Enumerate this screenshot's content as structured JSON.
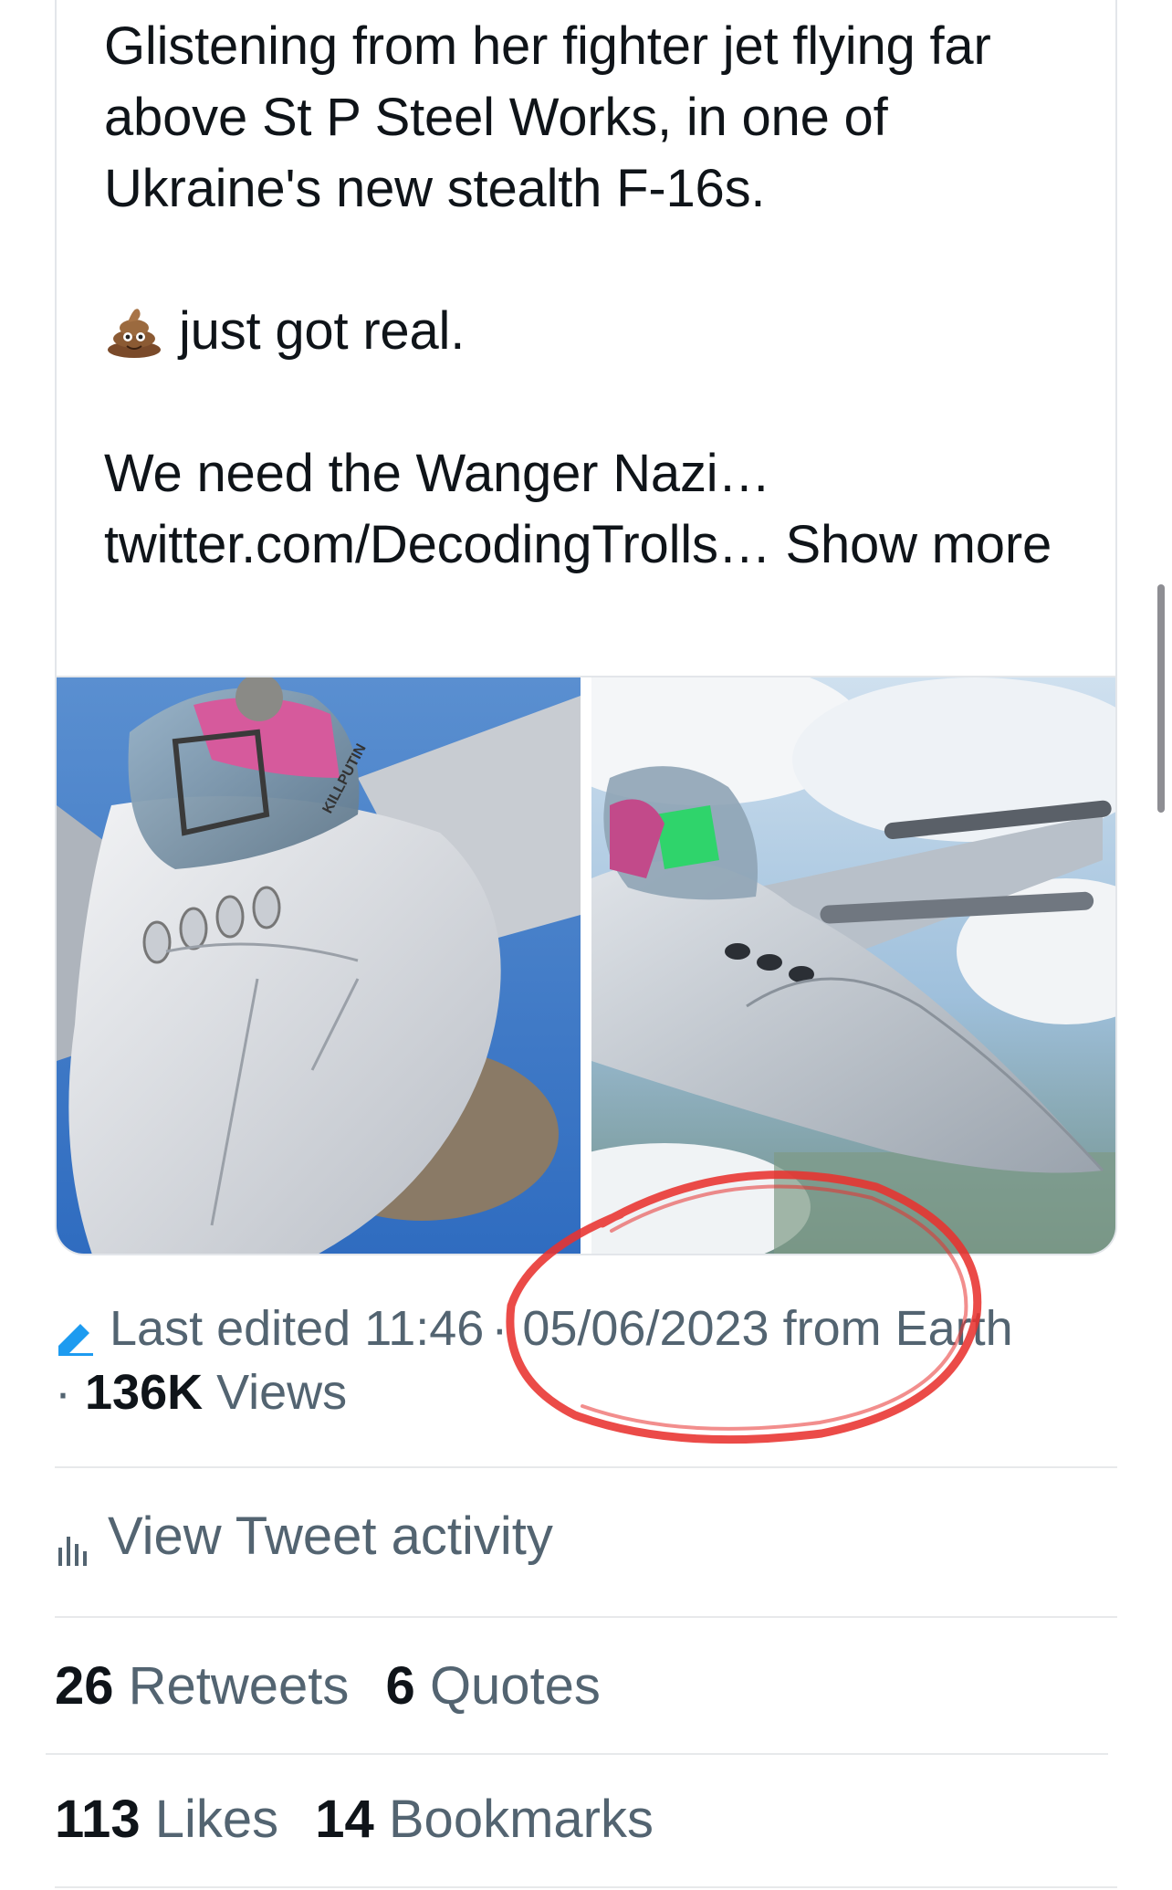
{
  "tweet": {
    "quoted_text": {
      "line1": " Glistening from her fighter jet flying far above St P Steel Works, in one of Ukraine's new stealth F-16s.",
      "line2": "just got real.",
      "line3": "We need the Wanger Nazi… twitter.com/DecodingTrolls…",
      "show_more": "Show more"
    },
    "images": [
      {
        "icon": "fighter-jet-cockpit-photo",
        "label": "KILLPUTIN"
      },
      {
        "icon": "fighter-jet-in-flight-photo"
      }
    ],
    "meta": {
      "edited_label": "Last edited",
      "time": "11:46",
      "date": "05/06/2023",
      "source": "from Earth",
      "views_count": "136K",
      "views_label": "Views"
    },
    "activity_label": "View Tweet activity",
    "stats": {
      "retweets_count": "26",
      "retweets_label": "Retweets",
      "quotes_count": "6",
      "quotes_label": "Quotes",
      "likes_count": "113",
      "likes_label": "Likes",
      "bookmarks_count": "14",
      "bookmarks_label": "Bookmarks"
    }
  },
  "colors": {
    "text_primary": "#0f1419",
    "text_secondary": "#536471",
    "accent": "#1d9bf0",
    "annotation_red": "#e8322f",
    "divider": "#e7e9eb"
  },
  "icons": {
    "edit": "pencil-icon",
    "activity": "analytics-icon",
    "emoji": "poop-emoji-icon"
  }
}
